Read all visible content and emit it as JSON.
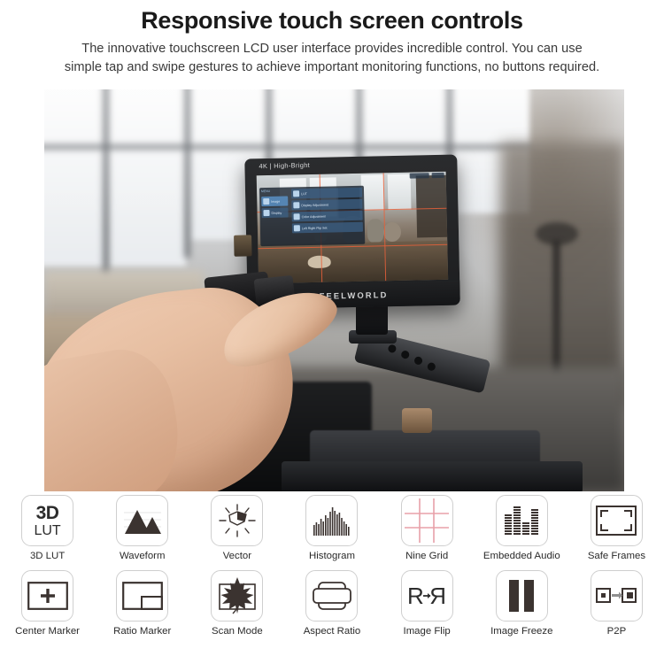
{
  "header": {
    "title": "Responsive touch screen controls",
    "subtitle_line1": "The innovative touchscreen LCD user interface provides incredible control. You can use",
    "subtitle_line2": "simple tap and swipe gestures to achieve important monitoring functions, no buttons required."
  },
  "photo": {
    "monitor": {
      "top_label": "4K | High-Bright",
      "brand": "FEELWORLD",
      "osd": {
        "tab_label": "MENU",
        "left_items": [
          "Image",
          "Display"
        ],
        "right_items": [
          "LUT",
          "Display Adjustment",
          "Color Adjustment",
          "Left Right Flip Set"
        ]
      }
    }
  },
  "features": {
    "row1": [
      {
        "label": "3D LUT",
        "icon": "3d-lut-icon",
        "text_main": "3D",
        "text_sub": "LUT"
      },
      {
        "label": "Waveform",
        "icon": "waveform-icon"
      },
      {
        "label": "Vector",
        "icon": "vector-scope-icon"
      },
      {
        "label": "Histogram",
        "icon": "histogram-icon"
      },
      {
        "label": "Nine Grid",
        "icon": "nine-grid-icon",
        "color": "#e8a0a8"
      },
      {
        "label": "Embedded Audio",
        "icon": "embedded-audio-icon"
      },
      {
        "label": "Safe Frames",
        "icon": "safe-frames-icon"
      }
    ],
    "row2": [
      {
        "label": "Center Marker",
        "icon": "center-marker-icon"
      },
      {
        "label": "Ratio Marker",
        "icon": "ratio-marker-icon"
      },
      {
        "label": "Scan Mode",
        "icon": "scan-mode-icon"
      },
      {
        "label": "Aspect Ratio",
        "icon": "aspect-ratio-icon"
      },
      {
        "label": "Image Flip",
        "icon": "image-flip-icon",
        "text_main": "R"
      },
      {
        "label": "Image Freeze",
        "icon": "image-freeze-icon"
      },
      {
        "label": "P2P",
        "icon": "p2p-icon"
      }
    ]
  },
  "colors": {
    "icon_dark": "#3b3330",
    "icon_border": "#cfcfcf",
    "grid_pink": "#e8a0a8",
    "text": "#2a2a2a"
  }
}
